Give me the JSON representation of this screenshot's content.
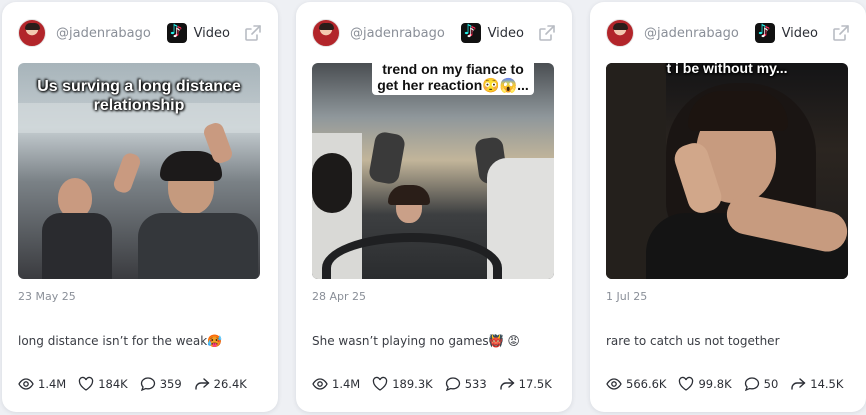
{
  "cards": [
    {
      "handle": "@jadenrabago",
      "platform": "Video",
      "overlay_text": "Us surving a long distance relationship",
      "date": "23 May 25",
      "description": "long distance isn’t for the weak🥵",
      "stats": {
        "views": "1.4M",
        "likes": "184K",
        "comments": "359",
        "shares": "26.4K"
      }
    },
    {
      "handle": "@jadenrabago",
      "platform": "Video",
      "overlay_text": "trend on my fiance to get her reaction😳😱...",
      "date": "28 Apr 25",
      "description": "She wasn’t playing no games👹 😡",
      "stats": {
        "views": "1.4M",
        "likes": "189.3K",
        "comments": "533",
        "shares": "17.5K"
      }
    },
    {
      "handle": "@jadenrabago",
      "platform": "Video",
      "overlay_text": "t i be without my...",
      "date": "1 Jul 25",
      "description": "rare to catch us not together",
      "stats": {
        "views": "566.6K",
        "likes": "99.8K",
        "comments": "50",
        "shares": "14.5K"
      }
    }
  ],
  "icons": {
    "platform": "tiktok-icon",
    "external": "external-link-icon",
    "views": "eye-icon",
    "likes": "heart-icon",
    "comments": "comment-icon",
    "shares": "share-icon"
  },
  "colors": {
    "muted_text": "#8a8f98",
    "body_text": "#2c2f36",
    "card_bg": "#ffffff",
    "page_bg": "#eef0f4"
  }
}
